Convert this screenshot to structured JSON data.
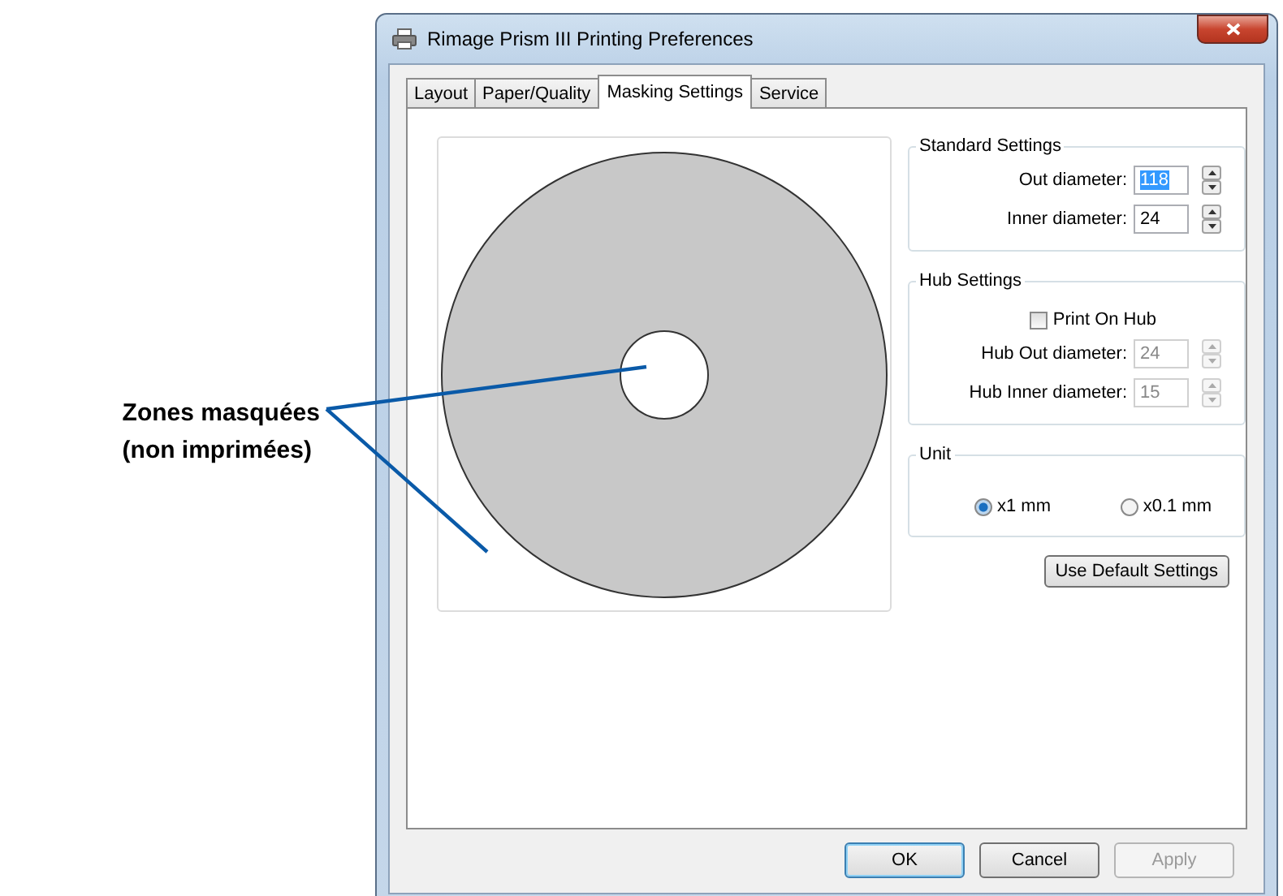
{
  "annotation": {
    "lines": [
      "Zones masquées",
      "(non imprimées)"
    ]
  },
  "window": {
    "title": "Rimage Prism III Printing Preferences"
  },
  "tabs": [
    {
      "label": "Layout",
      "selected": false
    },
    {
      "label": "Paper/Quality",
      "selected": false
    },
    {
      "label": "Masking Settings",
      "selected": true
    },
    {
      "label": "Service",
      "selected": false
    }
  ],
  "standard_settings": {
    "title": "Standard Settings",
    "fields": [
      {
        "label": "Out diameter:",
        "value": "118",
        "selected": true,
        "disabled": false
      },
      {
        "label": "Inner diameter:",
        "value": "24",
        "selected": false,
        "disabled": false
      }
    ]
  },
  "hub_settings": {
    "title": "Hub Settings",
    "checkbox": {
      "label": "Print On Hub",
      "checked": false
    },
    "fields": [
      {
        "label": "Hub Out diameter:",
        "value": "24",
        "selected": false,
        "disabled": true
      },
      {
        "label": "Hub Inner diameter:",
        "value": "15",
        "selected": false,
        "disabled": true
      }
    ]
  },
  "unit": {
    "title": "Unit",
    "options": [
      {
        "label": "x1 mm",
        "selected": true
      },
      {
        "label": "x0.1 mm",
        "selected": false
      }
    ]
  },
  "default_button": {
    "label": "Use Default Settings"
  },
  "buttons": [
    {
      "label": "OK",
      "kind": "default",
      "disabled": false
    },
    {
      "label": "Cancel",
      "kind": "normal",
      "disabled": false
    },
    {
      "label": "Apply",
      "kind": "normal",
      "disabled": true
    }
  ]
}
